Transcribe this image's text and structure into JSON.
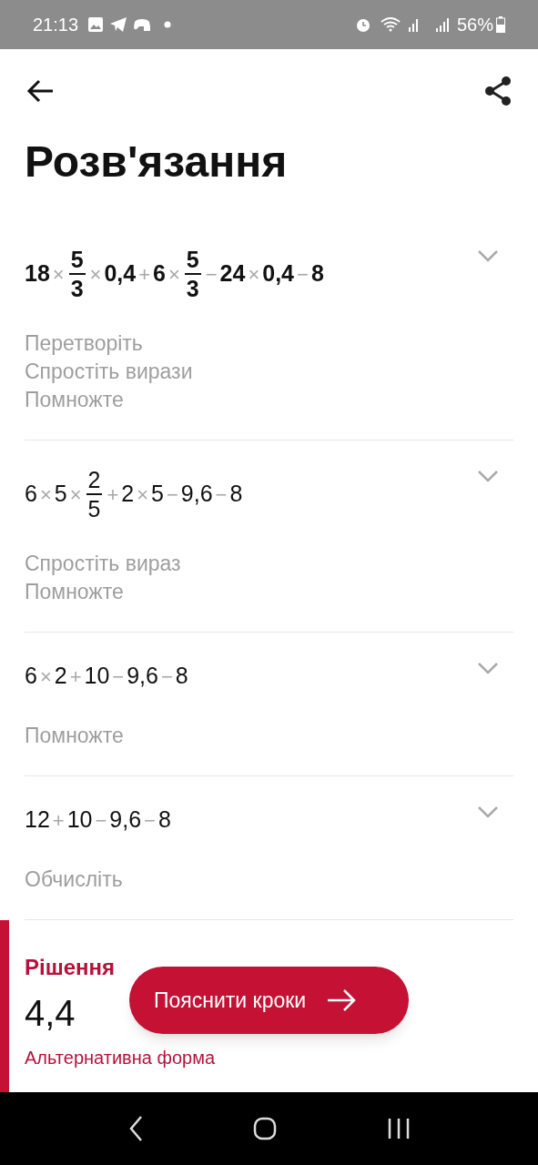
{
  "status_bar": {
    "time": "21:13",
    "battery": "56%"
  },
  "title": "Розв'язання",
  "steps": [
    {
      "emphasized": true,
      "expression": [
        {
          "kind": "num",
          "text": "18"
        },
        {
          "kind": "op",
          "text": "×"
        },
        {
          "kind": "frac",
          "num": "5",
          "den": "3"
        },
        {
          "kind": "op",
          "text": "×"
        },
        {
          "kind": "num",
          "text": "0,4"
        },
        {
          "kind": "op",
          "text": "+"
        },
        {
          "kind": "num",
          "text": "6"
        },
        {
          "kind": "op",
          "text": "×"
        },
        {
          "kind": "frac",
          "num": "5",
          "den": "3"
        },
        {
          "kind": "op",
          "text": "−"
        },
        {
          "kind": "num",
          "text": "24"
        },
        {
          "kind": "op",
          "text": "×"
        },
        {
          "kind": "num",
          "text": "0,4"
        },
        {
          "kind": "op",
          "text": "−"
        },
        {
          "kind": "num",
          "text": "8"
        }
      ],
      "hints": [
        "Перетворіть",
        "Спростіть вирази",
        "Помножте"
      ]
    },
    {
      "emphasized": false,
      "expression": [
        {
          "kind": "num",
          "text": "6"
        },
        {
          "kind": "op",
          "text": "×"
        },
        {
          "kind": "num",
          "text": "5"
        },
        {
          "kind": "op",
          "text": "×"
        },
        {
          "kind": "frac",
          "num": "2",
          "den": "5"
        },
        {
          "kind": "op",
          "text": "+"
        },
        {
          "kind": "num",
          "text": "2"
        },
        {
          "kind": "op",
          "text": "×"
        },
        {
          "kind": "num",
          "text": "5"
        },
        {
          "kind": "op",
          "text": "−"
        },
        {
          "kind": "num",
          "text": "9,6"
        },
        {
          "kind": "op",
          "text": "−"
        },
        {
          "kind": "num",
          "text": "8"
        }
      ],
      "hints": [
        "Спростіть вираз",
        "Помножте"
      ]
    },
    {
      "emphasized": false,
      "expression": [
        {
          "kind": "num",
          "text": "6"
        },
        {
          "kind": "op",
          "text": "×"
        },
        {
          "kind": "num",
          "text": "2"
        },
        {
          "kind": "op",
          "text": "+"
        },
        {
          "kind": "num",
          "text": "10"
        },
        {
          "kind": "op",
          "text": "−"
        },
        {
          "kind": "num",
          "text": "9,6"
        },
        {
          "kind": "op",
          "text": "−"
        },
        {
          "kind": "num",
          "text": "8"
        }
      ],
      "hints": [
        "Помножте"
      ]
    },
    {
      "emphasized": false,
      "expression": [
        {
          "kind": "num",
          "text": "12"
        },
        {
          "kind": "op",
          "text": "+"
        },
        {
          "kind": "num",
          "text": "10"
        },
        {
          "kind": "op",
          "text": "−"
        },
        {
          "kind": "num",
          "text": "9,6"
        },
        {
          "kind": "op",
          "text": "−"
        },
        {
          "kind": "num",
          "text": "8"
        }
      ],
      "hints": [
        "Обчисліть"
      ]
    }
  ],
  "solution": {
    "label": "Рішення",
    "value": "4,4",
    "alternative_label": "Альтернативна форма"
  },
  "explain_button": {
    "label": "Пояснити кроки"
  }
}
